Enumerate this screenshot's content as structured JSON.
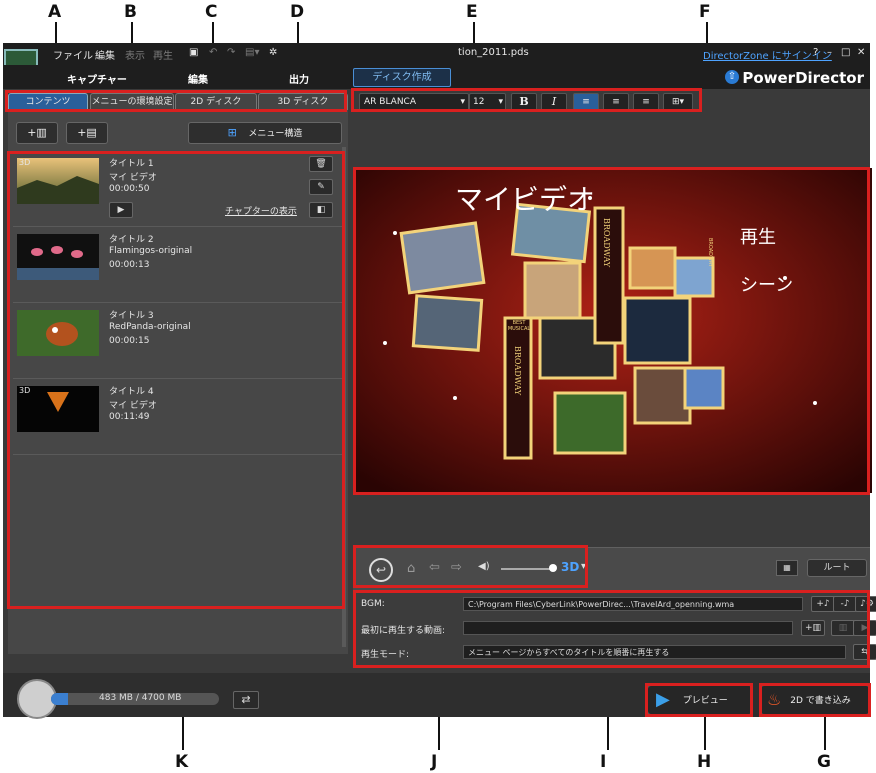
{
  "callouts": {
    "A": "A",
    "B": "B",
    "C": "C",
    "D": "D",
    "E": "E",
    "F": "F",
    "G": "G",
    "H": "H",
    "I": "I",
    "J": "J",
    "K": "K"
  },
  "menu": {
    "file": "ファイル",
    "edit": "編集",
    "view": "表示",
    "play": "再生"
  },
  "window": {
    "filename": "tion_2011.pds",
    "signin": "DirectorZone にサインイン",
    "help": "?",
    "minimize": "–",
    "restore": "□",
    "close": "✕"
  },
  "modes": {
    "capture": "キャプチャー",
    "edit": "編集",
    "output": "出力",
    "disc": "ディスク作成"
  },
  "brand": "PowerDirector",
  "tabs": {
    "content": "コンテンツ",
    "menu_settings": "メニューの環境設定",
    "disc2d": "2D ディスク",
    "disc3d": "3D ディスク"
  },
  "left_buttons": {
    "menu_structure": "メニュー構造"
  },
  "titles": [
    {
      "name": "タイトル 1",
      "sub": "マイ ビデオ",
      "duration": "00:00:50",
      "badge": "3D",
      "chapter_link": "チャプターの表示"
    },
    {
      "name": "タイトル 2",
      "sub": "Flamingos-original",
      "duration": "00:00:13",
      "badge": ""
    },
    {
      "name": "タイトル 3",
      "sub": "RedPanda-original",
      "duration": "00:00:15",
      "badge": ""
    },
    {
      "name": "タイトル 4",
      "sub": "マイ ビデオ",
      "duration": "00:11:49",
      "badge": "3D"
    }
  ],
  "format": {
    "font": "AR BLANCA",
    "size": "12",
    "bold": "B",
    "italic": "I"
  },
  "preview": {
    "title": "マイビデオ",
    "play": "再生",
    "scenes": "シーン",
    "sign1": "BROADWAY",
    "sign2": "BEST MUSICAL",
    "sign3": "BROADWAY",
    "sign4": "BROADWAY"
  },
  "controls": {
    "mode3d": "3D",
    "root": "ルート"
  },
  "bgm": {
    "bgm_label": "BGM:",
    "bgm_value": "C:\\Program Files\\CyberLink\\PowerDirec...\\TravelArd_openning.wma",
    "firstplay_label": "最初に再生する動画:",
    "firstplay_value": "",
    "playmode_label": "再生モード:",
    "playmode_value": "メニュー ページからすべてのタイトルを順番に再生する"
  },
  "bottom": {
    "capacity": "483 MB / 4700 MB",
    "preview": "プレビュー",
    "burn": "2D で書き込み"
  },
  "colors": {
    "accent": "#2a5f9a",
    "highlight": "#d9201f"
  }
}
